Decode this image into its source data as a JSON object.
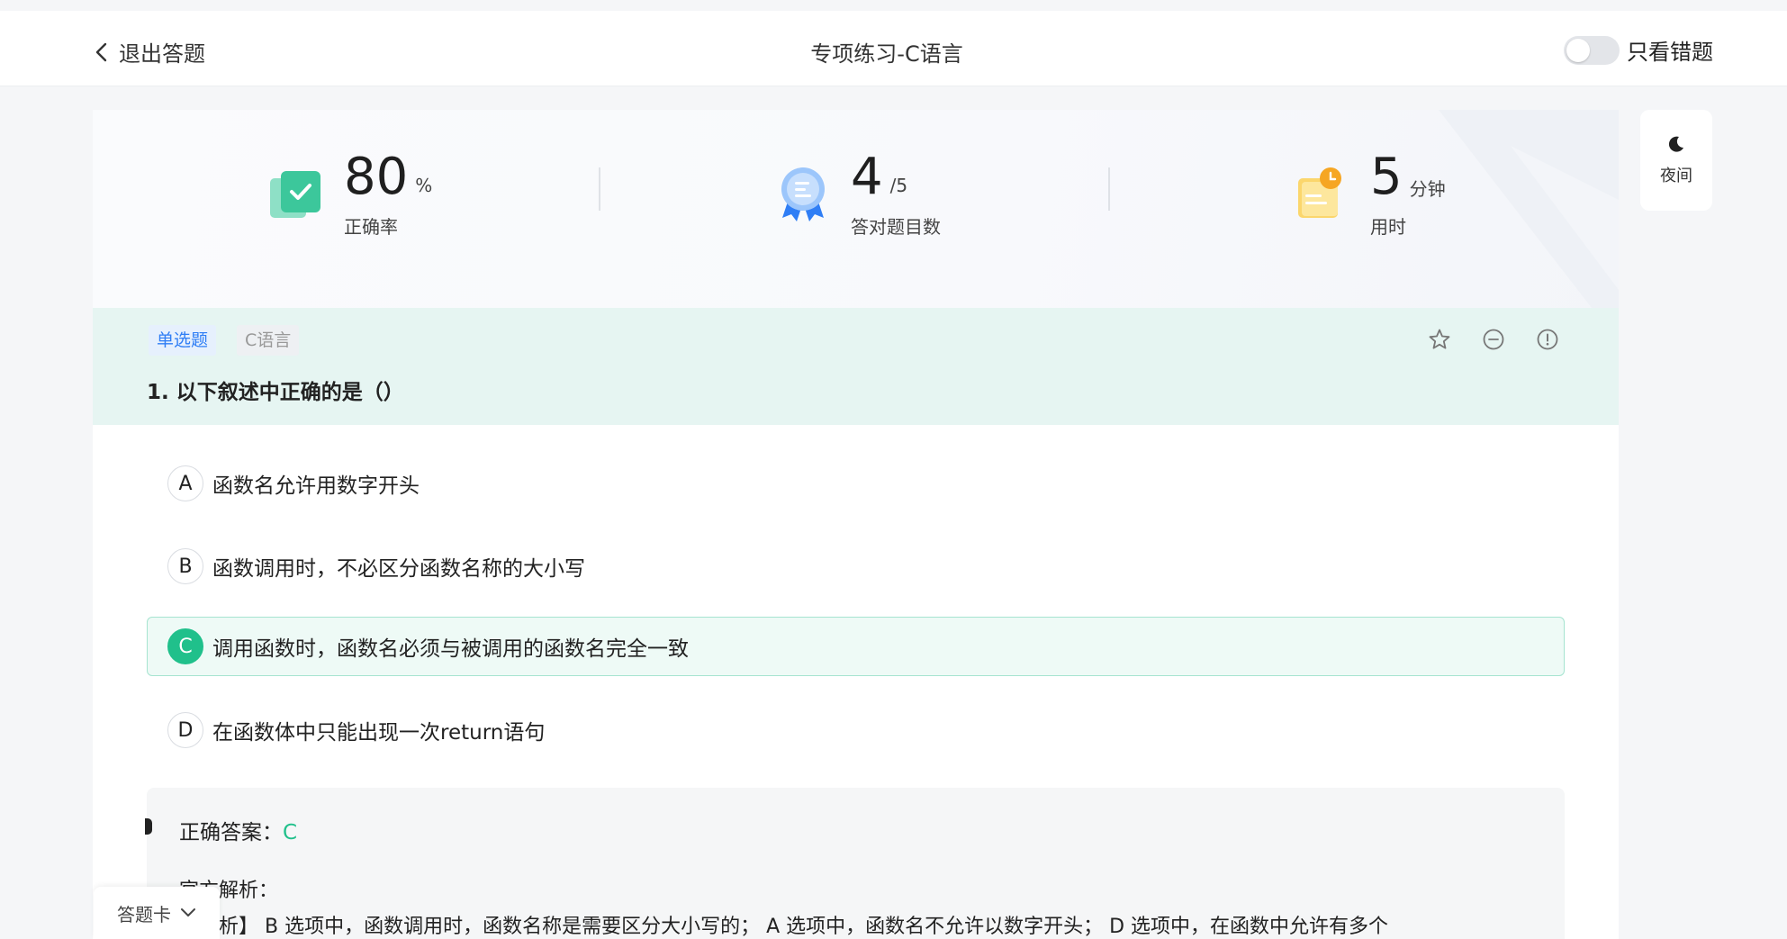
{
  "header": {
    "back_label": "退出答题",
    "title": "专项练习-C语言",
    "wrong_only_label": "只看错题",
    "wrong_only_on": false
  },
  "stats": [
    {
      "value": "80",
      "unit": "%",
      "label": "正确率",
      "icon": "correct-rate-icon"
    },
    {
      "value": "4",
      "unit": "/5",
      "label": "答对题目数",
      "icon": "award-medal-icon"
    },
    {
      "value": "5",
      "unit": "分钟",
      "label": "用时",
      "icon": "clock-note-icon"
    }
  ],
  "question": {
    "type_tag": "单选题",
    "subject_tag": "C语言",
    "title": "1. 以下叙述中正确的是（）",
    "options": [
      {
        "letter": "A",
        "text": "函数名允许用数字开头",
        "correct": false
      },
      {
        "letter": "B",
        "text": "函数调用时，不必区分函数名称的大小写",
        "correct": false
      },
      {
        "letter": "C",
        "text": "调用函数时，函数名必须与被调用的函数名完全一致",
        "correct": true
      },
      {
        "letter": "D",
        "text": "在函数体中只能出现一次return语句",
        "correct": false
      }
    ]
  },
  "analysis": {
    "answer_label": "正确答案：",
    "answer_value": "C",
    "section_title": "官方解析：",
    "text": "【解析】 B 选项中，函数调用时，函数名称是需要区分大小写的； A 选项中，函数名不允许以数字开头； D 选项中，在函数中允许有多个"
  },
  "night_label": "夜间",
  "answer_sheet_label": "答题卡",
  "colors": {
    "accent_green": "#20c08b",
    "tag_blue": "#2f7ef5",
    "question_bg": "#e6f5f2"
  }
}
